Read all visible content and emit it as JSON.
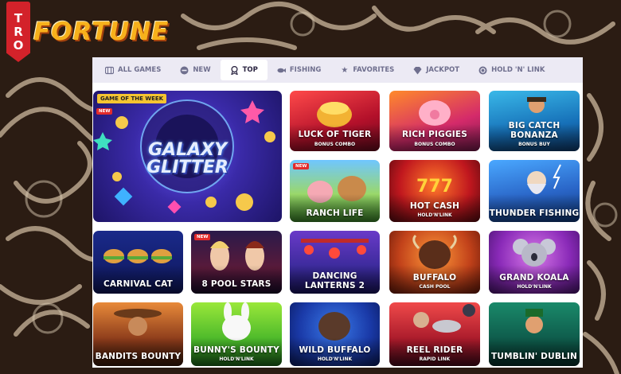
{
  "logo": {
    "tag_letters": [
      "T",
      "R",
      "O"
    ],
    "word": "FORTUNE"
  },
  "nav": [
    {
      "label": "ALL GAMES",
      "icon": "grid-icon"
    },
    {
      "label": "NEW",
      "icon": "new-icon"
    },
    {
      "label": "TOP",
      "icon": "trophy-icon",
      "active": true
    },
    {
      "label": "FISHING",
      "icon": "fish-icon"
    },
    {
      "label": "FAVORITES",
      "icon": "star-icon"
    },
    {
      "label": "JACKPOT",
      "icon": "diamond-icon"
    },
    {
      "label": "HOLD 'N' LINK",
      "icon": "coin-icon"
    }
  ],
  "featured": {
    "badge": "GAME OF THE WEEK",
    "new_badge": "NEW",
    "title_line1": "GALAXY",
    "title_line2": "GLITTER"
  },
  "games": [
    {
      "title": "LUCK OF TIGER",
      "sub": "BONUS COMBO"
    },
    {
      "title": "RICH PIGGIES",
      "sub": "BONUS COMBO"
    },
    {
      "title": "BIG CATCH BONANZA",
      "sub": "BONUS BUY"
    },
    {
      "title": "RANCH LIFE",
      "sub": "",
      "new": "NEW"
    },
    {
      "title": "HOT CASH",
      "sub": "HOLD'N'LINK"
    },
    {
      "title": "THUNDER FISHING",
      "sub": ""
    },
    {
      "title": "CARNIVAL CAT",
      "sub": ""
    },
    {
      "title": "8 POOL STARS",
      "sub": "",
      "new": "NEW"
    },
    {
      "title": "DANCING LANTERNS 2",
      "sub": ""
    },
    {
      "title": "BUFFALO",
      "sub": "CASH POOL"
    },
    {
      "title": "GRAND KOALA",
      "sub": "HOLD'N'LINK"
    },
    {
      "title": "BANDITS BOUNTY",
      "sub": ""
    },
    {
      "title": "BUNNY'S BOUNTY",
      "sub": "HOLD'N'LINK"
    },
    {
      "title": "WILD BUFFALO",
      "sub": "HOLD'N'LINK"
    },
    {
      "title": "REEL RIDER",
      "sub": "RAPID LINK"
    },
    {
      "title": "TUMBLIN' DUBLIN",
      "sub": ""
    }
  ]
}
